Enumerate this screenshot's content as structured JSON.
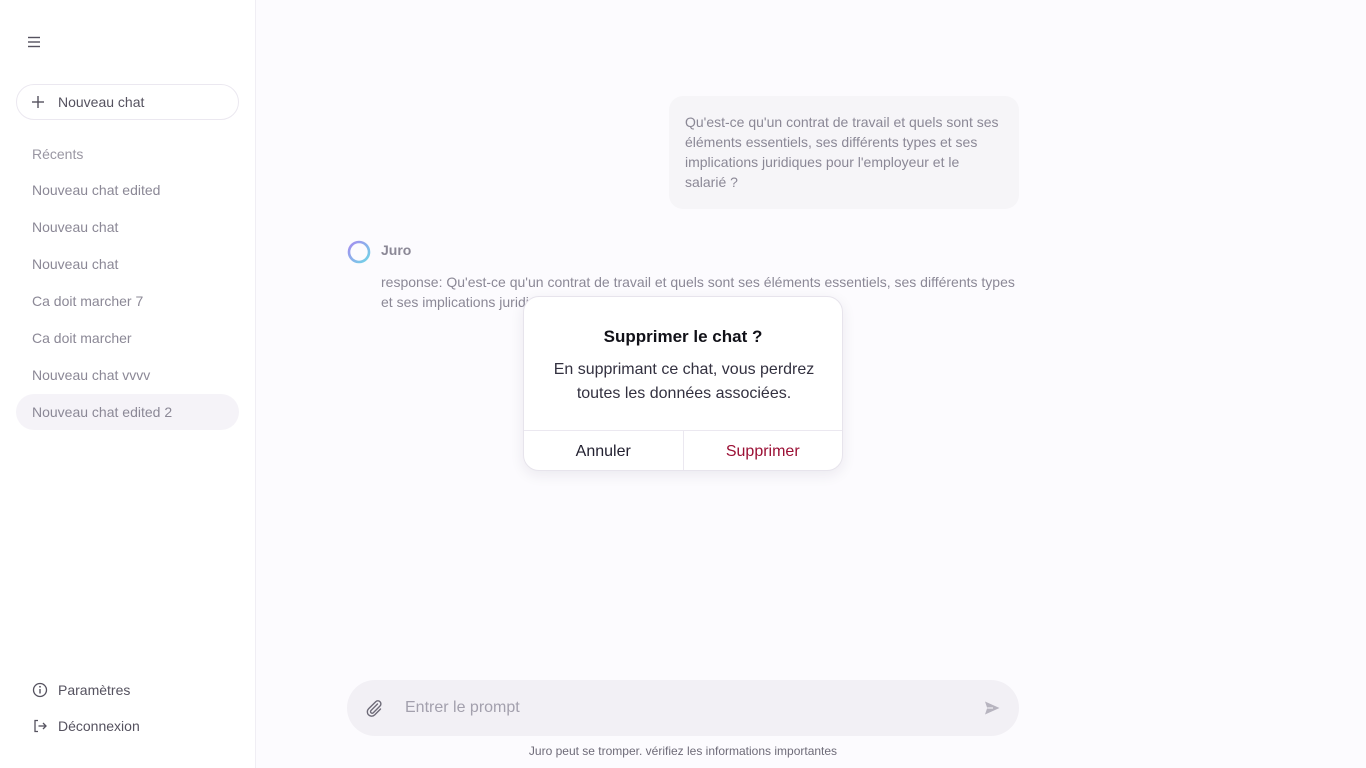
{
  "sidebar": {
    "new_chat_label": "Nouveau chat",
    "recents_title": "Récents",
    "chats": [
      {
        "label": "Nouveau chat edited"
      },
      {
        "label": "Nouveau chat"
      },
      {
        "label": "Nouveau chat"
      },
      {
        "label": "Ca doit marcher 7"
      },
      {
        "label": "Ca doit marcher"
      },
      {
        "label": "Nouveau chat vvvv"
      },
      {
        "label": "Nouveau chat edited 2",
        "active": true
      }
    ],
    "settings_label": "Paramètres",
    "logout_label": "Déconnexion"
  },
  "conversation": {
    "user_message": "Qu'est-ce qu'un contrat de travail et quels sont ses éléments essentiels, ses différents types et ses implications juridiques pour l'employeur et le salarié ?",
    "bot_name": "Juro",
    "bot_message": "response: Qu'est-ce qu'un contrat de travail et quels sont ses éléments essentiels, ses différents types et ses implications juridiques pour l'employeur et le salarié ?"
  },
  "modal": {
    "title": "Supprimer le chat ?",
    "body": "En supprimant ce chat, vous perdrez toutes les données associées.",
    "cancel_label": "Annuler",
    "delete_label": "Supprimer"
  },
  "prompt": {
    "placeholder": "Entrer le prompt",
    "value": ""
  },
  "disclaimer": "Juro peut se tromper. vérifiez les informations importantes",
  "colors": {
    "background": "#fcfbfe",
    "sidebar": "#ffffff",
    "delete_accent": "#9b1035",
    "prompt_bg": "#f2f0f5"
  }
}
